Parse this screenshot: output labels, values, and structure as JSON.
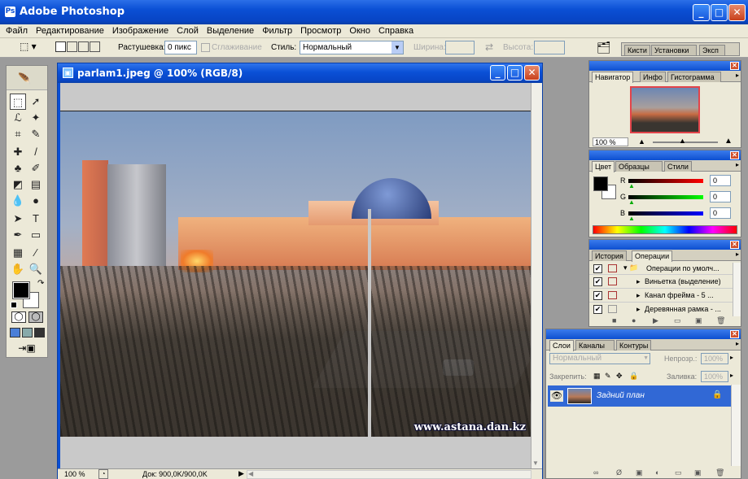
{
  "app": {
    "title": "Adobe Photoshop"
  },
  "menu": [
    "Файл",
    "Редактирование",
    "Изображение",
    "Слой",
    "Выделение",
    "Фильтр",
    "Просмотр",
    "Окно",
    "Справка"
  ],
  "options": {
    "feather_label": "Растушевка:",
    "feather_value": "0 пикс",
    "antialias_label": "Сглаживание",
    "style_label": "Стиль:",
    "style_value": "Нормальный",
    "width_label": "Ширина:",
    "height_label": "Высота:",
    "well_tabs": [
      "Кисти",
      "Установки",
      "Эксп"
    ]
  },
  "document": {
    "title": "parlam1.jpeg @ 100% (RGB/8)",
    "zoom": "100 %",
    "doc_size": "Док: 900,0K/900,0K",
    "watermark": "www.astana.dan.kz"
  },
  "navigator": {
    "tabs": [
      "Навигатор",
      "Инфо",
      "Гистограмма"
    ],
    "zoom": "100 %"
  },
  "color": {
    "tabs": [
      "Цвет",
      "Образцы",
      "Стили"
    ],
    "r_label": "R",
    "g_label": "G",
    "b_label": "B",
    "r_value": "0",
    "g_value": "0",
    "b_value": "0"
  },
  "history": {
    "tabs": [
      "История",
      "Операции"
    ],
    "actions": [
      "Операции по умолч...",
      "Виньетка (выделение)",
      "Канал фрейма - 5 ...",
      "Деревянная рамка - ..."
    ]
  },
  "layers": {
    "tabs": [
      "Слои",
      "Каналы",
      "Контуры"
    ],
    "blend_mode": "Нормальный",
    "opacity_label": "Непрозр.:",
    "opacity_value": "100%",
    "lock_label": "Закрепить:",
    "fill_label": "Заливка:",
    "fill_value": "100%",
    "layer_name": "Задний план"
  },
  "colors": {
    "xp_blue": "#0a4fd4",
    "palette_bg": "#ece9d8",
    "layer_selected": "#3168d5"
  }
}
